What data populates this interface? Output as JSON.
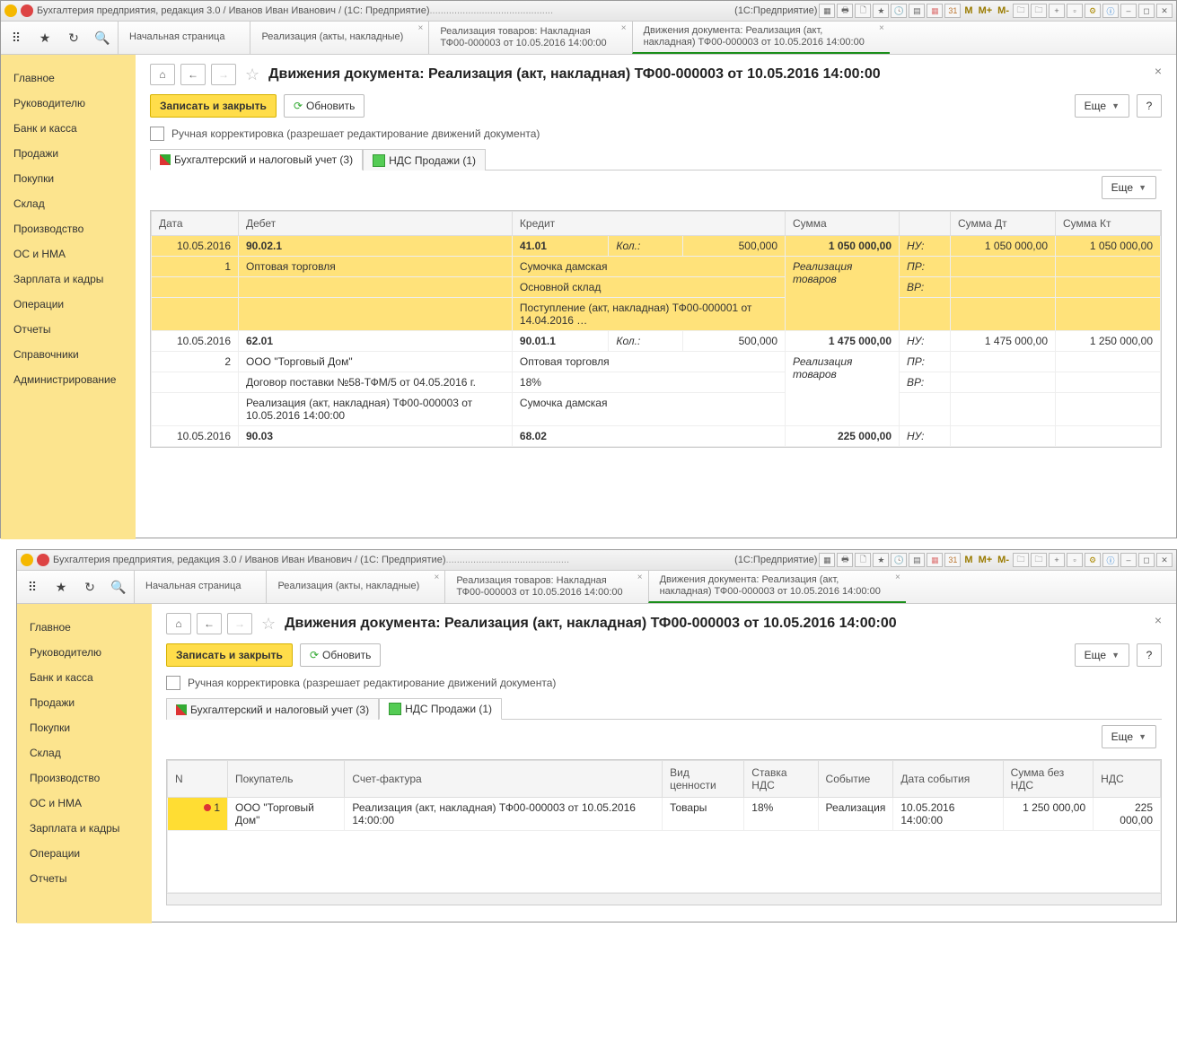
{
  "app_title": "Бухгалтерия предприятия, редакция 3.0 / Иванов Иван Иванович / (1С: Предприятие)",
  "titlebar_right_label": "(1С:Предприятие)",
  "m_labels": [
    "M",
    "M+",
    "M-"
  ],
  "tabs": [
    {
      "l1": "Начальная страница",
      "l2": ""
    },
    {
      "l1": "Реализация (акты, накладные)",
      "l2": ""
    },
    {
      "l1": "Реализация товаров: Накладная",
      "l2": "ТФ00-000003 от 10.05.2016 14:00:00"
    },
    {
      "l1": "Движения документа: Реализация (акт,",
      "l2": "накладная) ТФ00-000003 от 10.05.2016 14:00:00"
    }
  ],
  "sidebar": [
    "Главное",
    "Руководителю",
    "Банк и касса",
    "Продажи",
    "Покупки",
    "Склад",
    "Производство",
    "ОС и НМА",
    "Зарплата и кадры",
    "Операции",
    "Отчеты",
    "Справочники",
    "Администрирование"
  ],
  "sidebar2": [
    "Главное",
    "Руководителю",
    "Банк и касса",
    "Продажи",
    "Покупки",
    "Склад",
    "Производство",
    "ОС и НМА",
    "Зарплата и кадры",
    "Операции",
    "Отчеты"
  ],
  "page_title": "Движения документа: Реализация (акт, накладная) ТФ00-000003 от 10.05.2016 14:00:00",
  "buttons": {
    "save": "Записать и закрыть",
    "refresh": "Обновить",
    "more": "Еще",
    "help": "?"
  },
  "checkbox_label": "Ручная корректировка (разрешает редактирование движений документа)",
  "subtabs": {
    "acc": "Бухгалтерский и налоговый учет (3)",
    "vat": "НДС Продажи (1)"
  },
  "grid1": {
    "headers": [
      "Дата",
      "Дебет",
      "Кредит",
      "Сумма",
      "Сумма Дт",
      "Сумма Кт"
    ],
    "kol": "Кол.:",
    "nu": "НУ:",
    "pr": "ПР:",
    "vr": "ВР:",
    "r1": {
      "date": "10.05.2016",
      "n": "1",
      "dt": "90.02.1",
      "dt2": "Оптовая торговля",
      "kt": "41.01",
      "kt_qty": "500,000",
      "kt2": "Сумочка дамская",
      "kt3": "Основной склад",
      "kt4": "Поступление (акт, накладная) ТФ00-000001 от 14.04.2016 …",
      "sum": "1 050 000,00",
      "desc": "Реализация товаров",
      "sdt": "1 050 000,00",
      "skt": "1 050 000,00"
    },
    "r2": {
      "date": "10.05.2016",
      "n": "2",
      "dt": "62.01",
      "dt2": "ООО \"Торговый Дом\"",
      "dt3": "Договор поставки №58-ТФМ/5 от 04.05.2016 г.",
      "dt4": "Реализация (акт, накладная) ТФ00-000003 от 10.05.2016 14:00:00",
      "kt": "90.01.1",
      "kt_qty": "500,000",
      "kt2": "Оптовая торговля",
      "kt3": "18%",
      "kt4": "Сумочка дамская",
      "sum": "1 475 000,00",
      "desc": "Реализация товаров",
      "sdt": "1 475 000,00",
      "skt": "1 250 000,00"
    },
    "r3": {
      "date": "10.05.2016",
      "dt": "90.03",
      "kt": "68.02",
      "sum": "225 000,00"
    }
  },
  "grid2": {
    "headers": [
      "N",
      "Покупатель",
      "Счет-фактура",
      "Вид ценности",
      "Ставка НДС",
      "Событие",
      "Дата события",
      "Сумма без НДС",
      "НДС"
    ],
    "row": {
      "n": "1",
      "buyer": "ООО \"Торговый Дом\"",
      "sf": "Реализация (акт, накладная) ТФ00-000003 от 10.05.2016 14:00:00",
      "type": "Товары",
      "rate": "18%",
      "event": "Реализация",
      "date": "10.05.2016 14:00:00",
      "sum": "1 250 000,00",
      "vat": "225 000,00"
    }
  }
}
